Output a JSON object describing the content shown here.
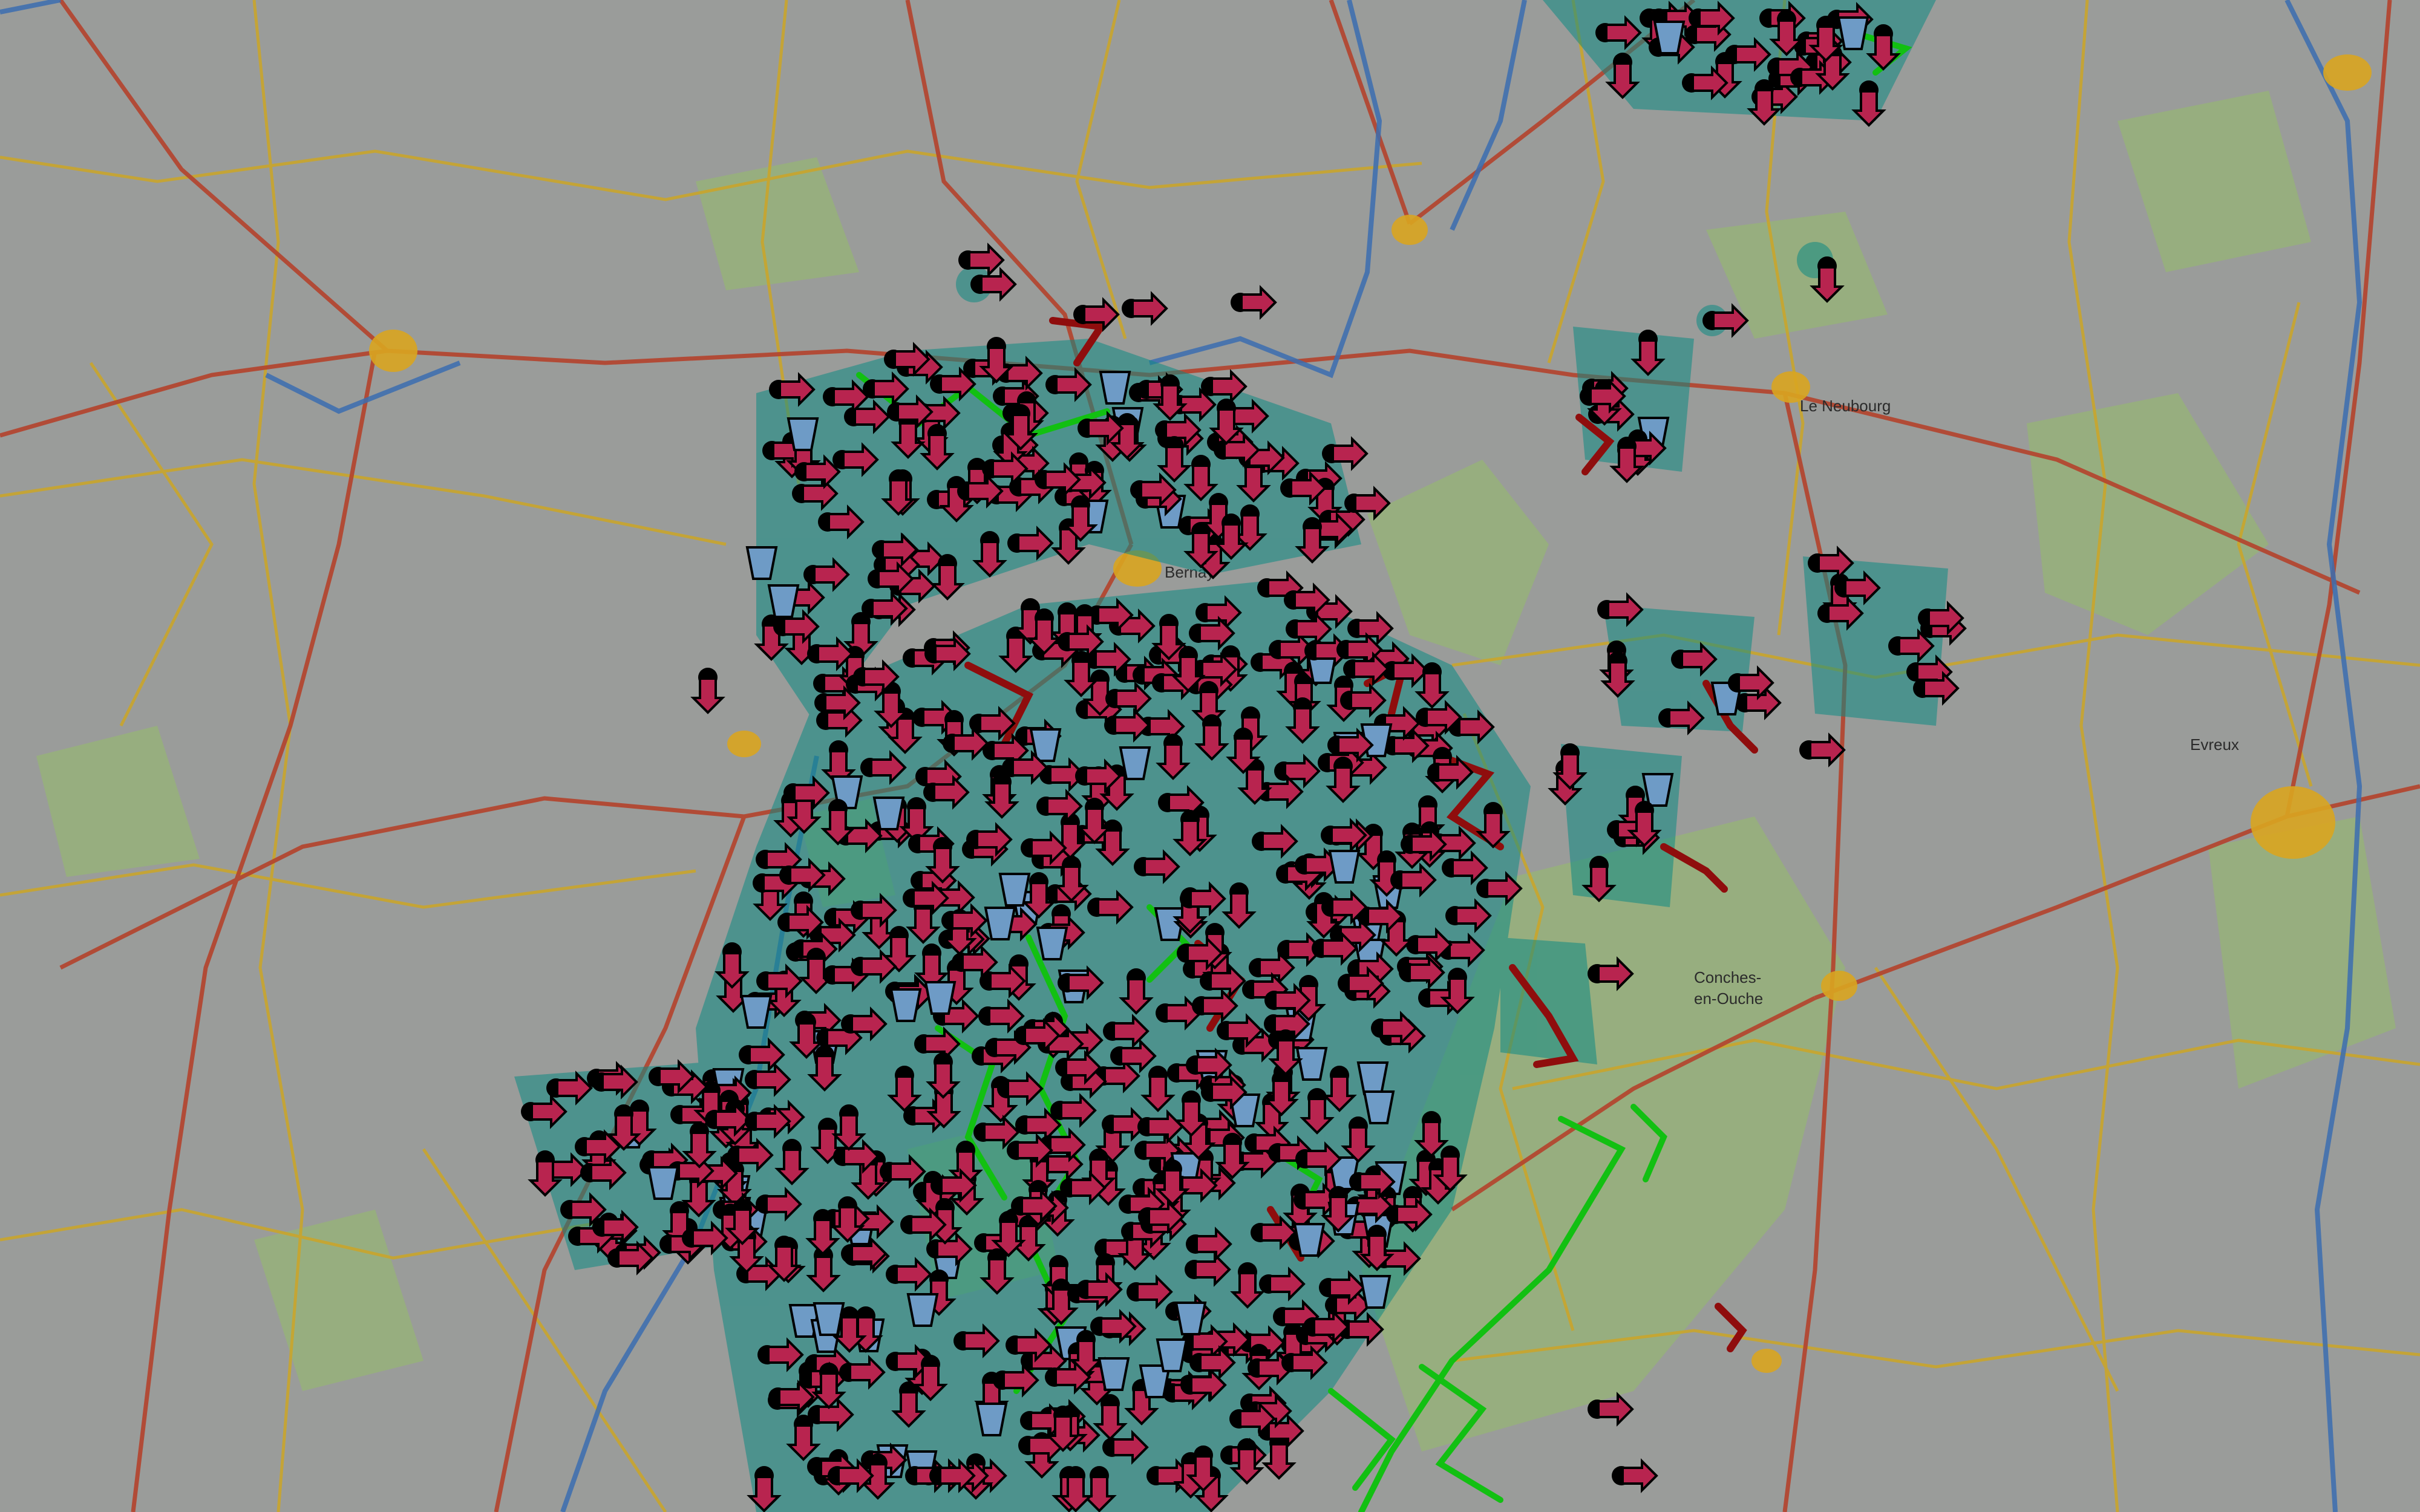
{
  "map": {
    "labels": {
      "bernay": "Bernay",
      "le_neubourg": "Le Neubourg",
      "conches_line1": "Conches-",
      "conches_line2": "en-Ouche",
      "evreux": "Evreux"
    }
  },
  "colors": {
    "background": "#9a9c9a",
    "forest": "#97b27a",
    "road_major": "#b4432c",
    "road_minor": "#c9a52c",
    "river": "#3b6db0",
    "town": "#d9a520",
    "arrow_fill": "#b8244f",
    "arrow_alt_fill": "#6e9bc6",
    "marker_dot": "#000000",
    "halo": "#0e8a83",
    "track_green": "#12c012",
    "track_red": "#8f0d0d"
  },
  "icons": {
    "arrow_right": "arrow-right-marker-icon",
    "arrow_down": "arrow-down-marker-icon",
    "funnel": "funnel-marker-icon"
  }
}
